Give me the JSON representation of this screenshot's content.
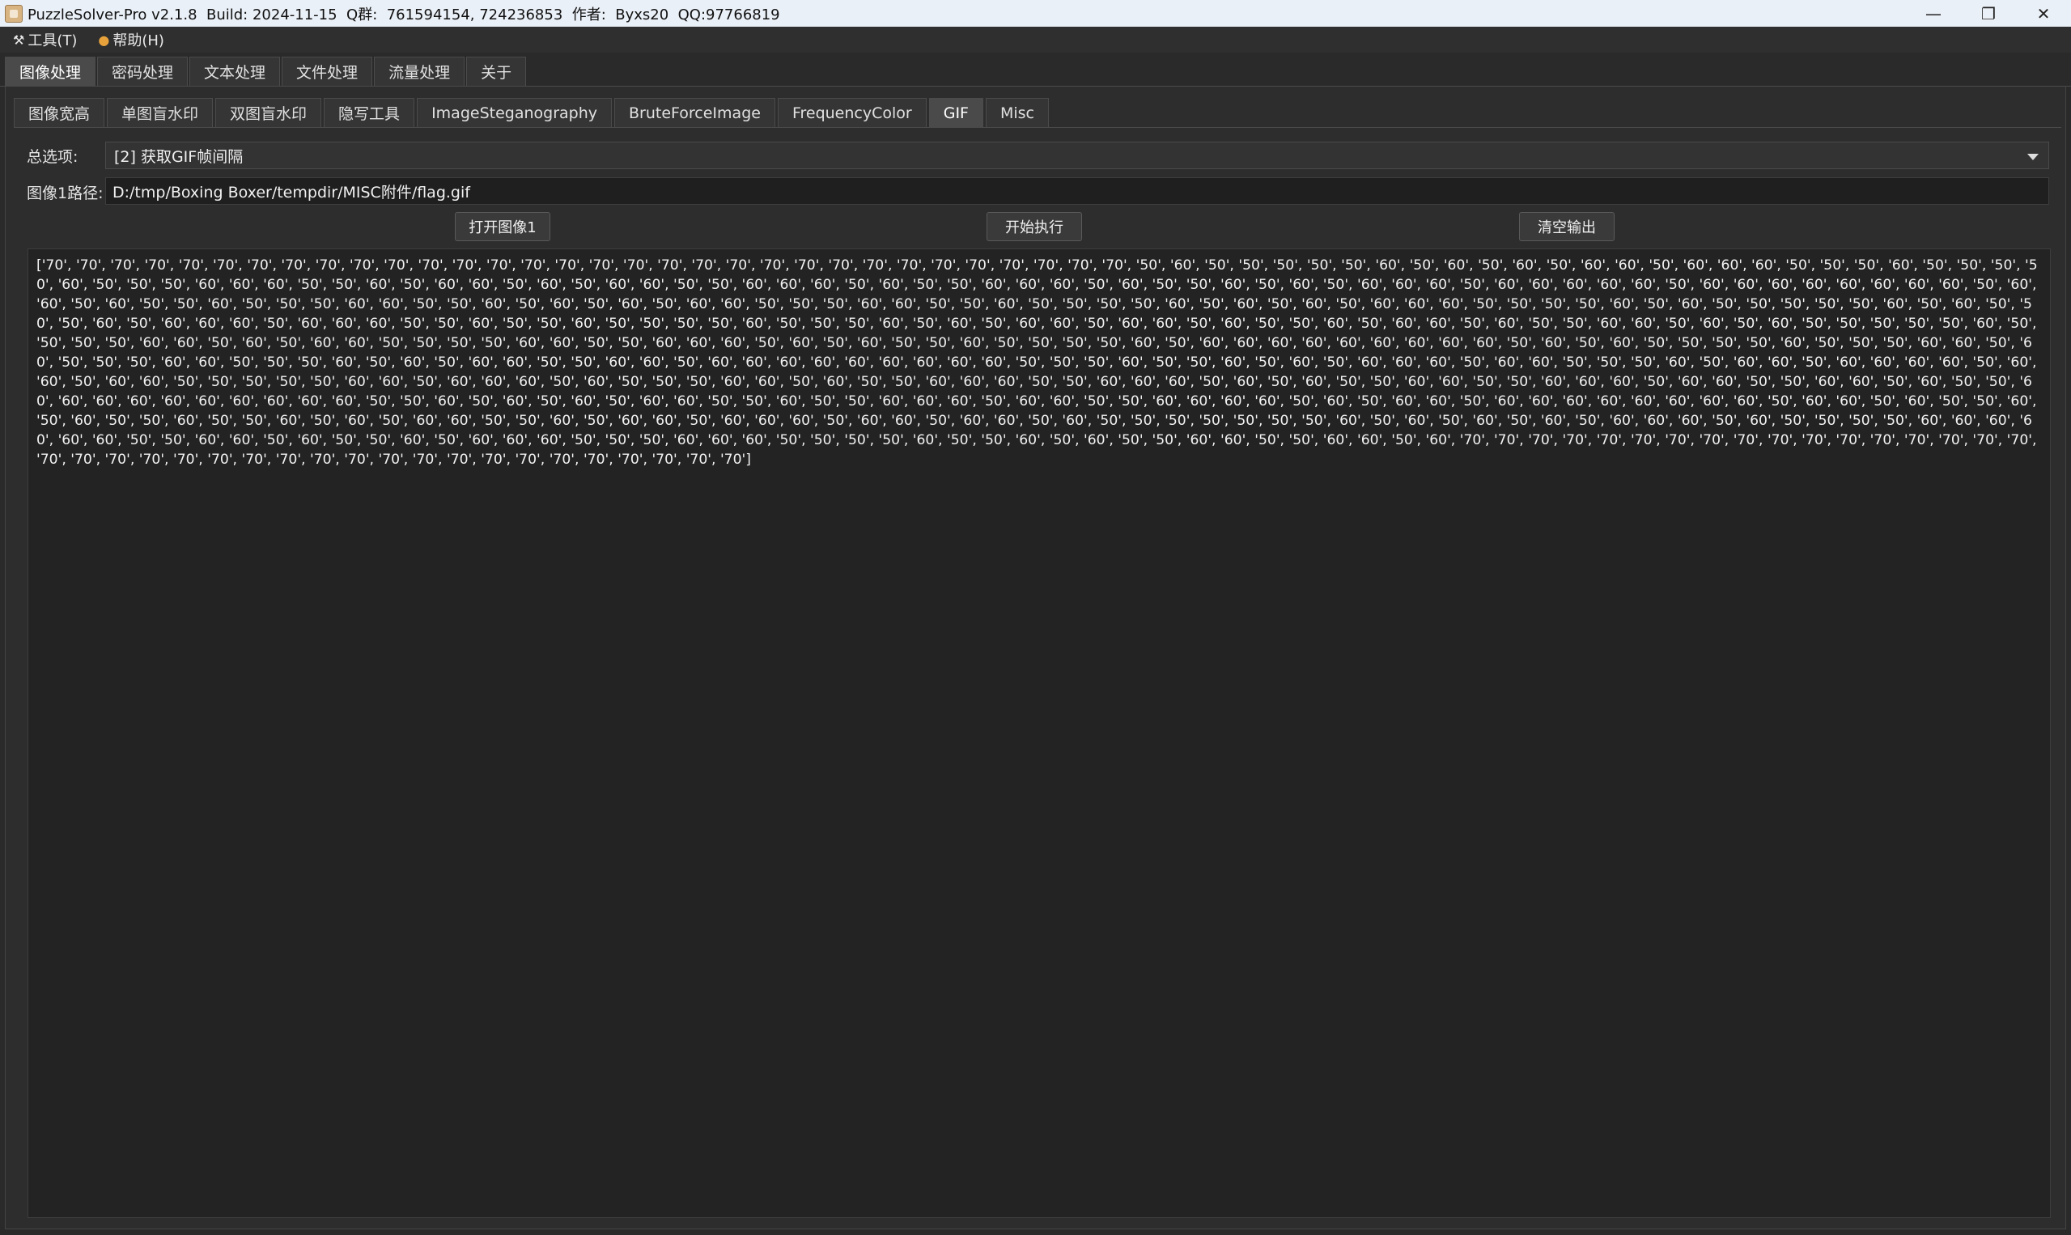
{
  "window": {
    "title": "PuzzleSolver-Pro v2.1.8  Build: 2024-11-15  Q群:  761594154, 724236853  作者:  Byxs20  QQ:97766819",
    "minimize": "—",
    "maximize": "❐",
    "close": "✕"
  },
  "menu": {
    "tools": "工具(T)",
    "help": "帮助(H)"
  },
  "main_tabs": [
    {
      "label": "图像处理",
      "active": true
    },
    {
      "label": "密码处理"
    },
    {
      "label": "文本处理"
    },
    {
      "label": "文件处理"
    },
    {
      "label": "流量处理"
    },
    {
      "label": "关于"
    }
  ],
  "sub_tabs": [
    {
      "label": "图像宽高"
    },
    {
      "label": "单图盲水印"
    },
    {
      "label": "双图盲水印"
    },
    {
      "label": "隐写工具"
    },
    {
      "label": "ImageSteganography"
    },
    {
      "label": "BruteForceImage"
    },
    {
      "label": "FrequencyColor"
    },
    {
      "label": "GIF",
      "active": true
    },
    {
      "label": "Misc"
    }
  ],
  "form": {
    "option_label": "总选项:",
    "option_value": "[2] 获取GIF帧间隔",
    "path_label": "图像1路径:",
    "path_value": "D:/tmp/Boxing Boxer/tempdir/MISC附件/flag.gif"
  },
  "buttons": {
    "open": "打开图像1",
    "run": "开始执行",
    "clear": "清空输出"
  },
  "output": {
    "text": "['70', '70', '70', '70', '70', '70', '70', '70', '70', '70', '70', '70', '70', '70', '70', '70', '70', '70', '70', '70', '70', '70', '70', '70', '70', '70', '70', '70', '70', '70', '70', '70', '50', '60', '50', '50', '50', '50', '50', '60', '50', '60', '50', '60', '50', '60', '60', '50', '60', '60', '60', '50', '50', '50', '60', '50', '50', '50', '50', '60', '50', '50', '50', '60', '60', '60', '50', '50', '60', '50', '60', '60', '50', '60', '50', '60', '60', '50', '50', '60', '60', '60', '50', '60', '50', '50', '60', '60', '60', '50', '60', '50', '50', '60', '50', '60', '50', '60', '60', '60', '50', '60', '60', '60', '60', '60', '50', '60', '60', '60', '60', '60', '60', '60', '60', '50', '60', '60', '50', '60', '50', '50', '60', '50', '50', '50', '60', '60', '50', '50', '60', '50', '60', '50', '60', '50', '60', '60', '50', '50', '50', '60', '60', '50', '50', '60', '50', '50', '50', '50', '60', '50', '60', '50', '60', '50', '60', '60', '60', '50', '50', '50', '50', '60', '50', '60', '50', '50', '50', '50', '50', '60', '50', '60', '50', '50', '50', '60', '50', '60', '60', '60', '50', '60', '60', '60', '50', '50', '60', '50', '50', '60', '50', '50', '50', '50', '60', '50', '50', '50', '60', '50', '60', '50', '60', '60', '50', '60', '60', '50', '60', '50', '50', '60', '50', '60', '60', '50', '60', '50', '50', '60', '60', '50', '60', '50', '60', '50', '50', '50', '50', '50', '60', '50', '50', '50', '50', '60', '60', '50', '60', '50', '60', '60', '50', '50', '50', '50', '60', '60', '50', '50', '60', '60', '60', '50', '60', '50', '60', '50', '50', '60', '50', '50', '50', '50', '60', '50', '60', '60', '60', '60', '60', '60', '60', '60', '60', '50', '60', '50', '60', '50', '50', '50', '50', '60', '50', '50', '50', '60', '60', '50', '60', '50', '50', '50', '60', '60', '50', '50', '50', '60', '50', '60', '50', '60', '60', '50', '50', '60', '60', '50', '60', '60', '60', '60', '60', '60', '60', '60', '60', '50', '50', '50', '60', '50', '50', '60', '50', '60', '50', '60', '60', '60', '50', '60', '60', '50', '50', '50', '60', '50', '60', '60', '50', '60', '60', '60', '60', '50', '60', '60', '50', '60', '60', '50', '50', '50', '50', '50', '60', '60', '50', '60', '60', '60', '50', '60', '50', '50', '50', '60', '60', '50', '60', '50', '50', '60', '60', '60', '50', '50', '60', '60', '60', '50', '60', '50', '60', '50', '50', '60', '60', '50', '50', '60', '60', '60', '50', '60', '60', '50', '50', '60', '60', '50', '60', '50', '50', '60', '60', '60', '60', '60', '60', '60', '60', '60', '60', '50', '50', '60', '50', '60', '50', '60', '50', '60', '60', '50', '50', '60', '50', '50', '60', '60', '60', '50', '60', '60', '50', '50', '60', '60', '60', '60', '50', '60', '50', '60', '60', '50', '60', '60', '60', '60', '60', '60', '60', '60', '50', '60', '60', '50', '60', '50', '50', '60', '50', '60', '50', '50', '60', '50', '50', '60', '50', '60', '50', '60', '60', '50', '50', '60', '50', '60', '60', '50', '60', '60', '60', '50', '60', '60', '50', '60', '60', '50', '60', '50', '50', '50', '50', '50', '50', '50', '60', '50', '60', '50', '60', '50', '60', '50', '60', '60', '60', '50', '60', '50', '50', '50', '50', '60', '60', '60', '60', '60', '60', '50', '50', '60', '60', '50', '60', '50', '50', '60', '50', '60', '60', '60', '50', '50', '50', '60', '60', '60', '50', '50', '50', '50', '60', '50', '50', '60', '50', '60', '50', '50', '60', '60', '50', '50', '60', '60', '50', '60', '70', '70', '70', '70', '70', '70', '70', '70', '70', '70', '70', '70', '70', '70', '70', '70', '70', '70', '70', '70', '70', '70', '70', '70', '70', '70', '70', '70', '70', '70', '70', '70', '70', '70', '70', '70', '70', '70']"
  },
  "colors": {
    "window_bg": "#2a2a2a",
    "output_bg": "#232323",
    "titlebar_bg": "#eaf0f7"
  }
}
